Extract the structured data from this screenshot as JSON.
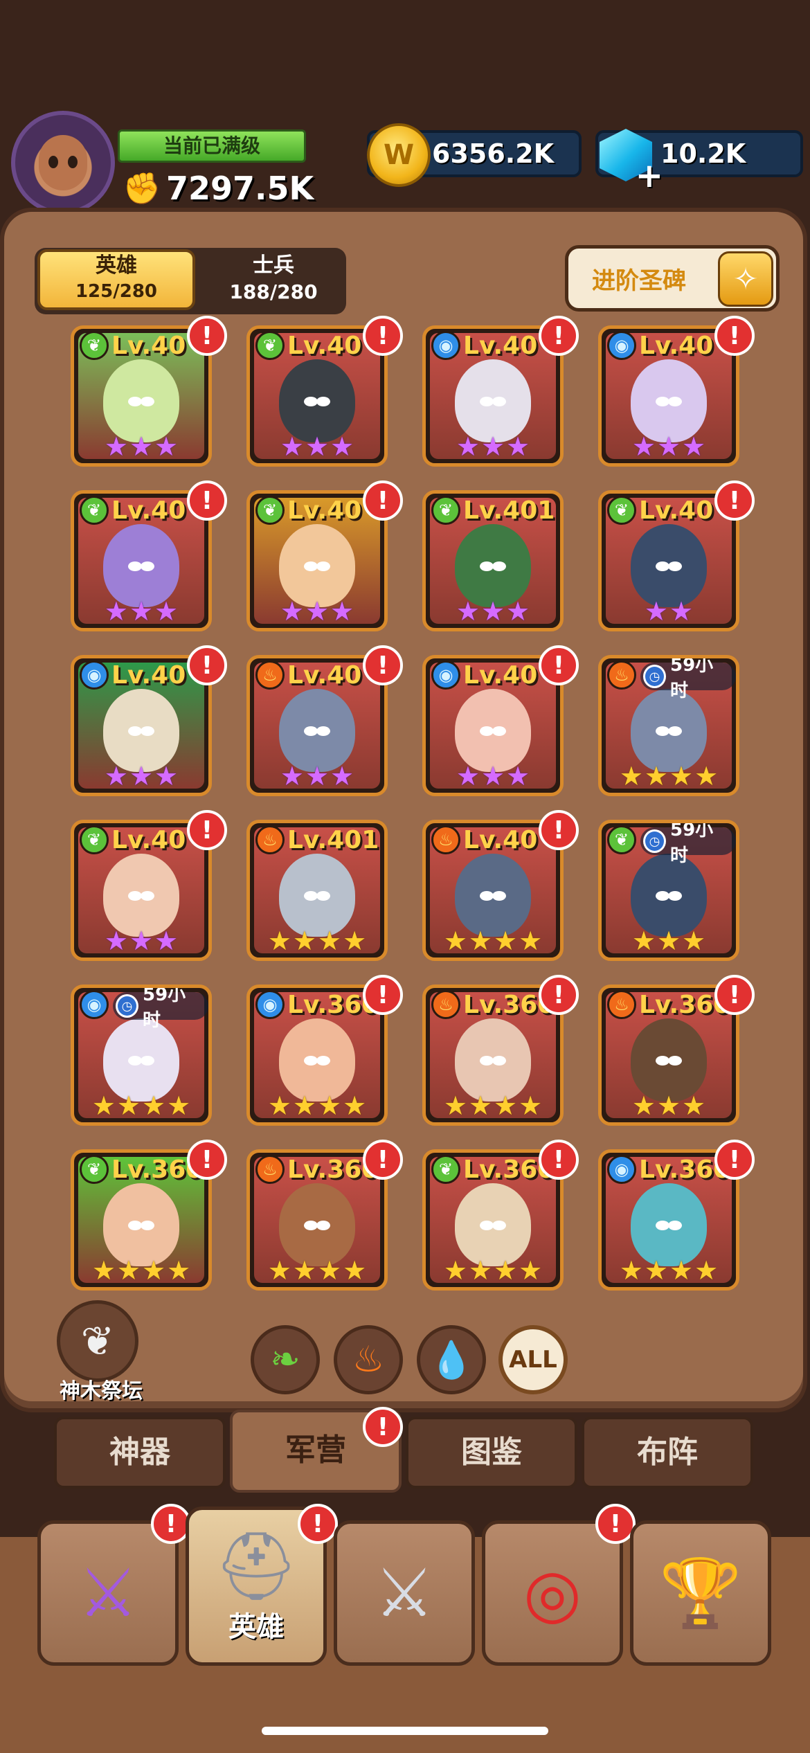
{
  "player": {
    "status_label": "当前已满级",
    "power": "7297.5K"
  },
  "resources": {
    "gold": "6356.2K",
    "gems": "10.2K"
  },
  "hero_tabs": {
    "hero_label": "英雄",
    "hero_count": "125/280",
    "soldier_label": "士兵",
    "soldier_count": "188/280"
  },
  "advance_button": {
    "label": "进阶圣碑",
    "icon": "compass-icon"
  },
  "heroes": [
    {
      "element": "leaf",
      "level": "Lv.40",
      "stars": 3,
      "star_color": "purple",
      "alert": true,
      "art": "#7bbf5a",
      "skin": "#cfe8a0"
    },
    {
      "element": "leaf",
      "level": "Lv.40",
      "stars": 3,
      "star_color": "purple",
      "alert": true,
      "art": "#c85048",
      "skin": "#3a3f45"
    },
    {
      "element": "water",
      "level": "Lv.40",
      "stars": 3,
      "star_color": "purple",
      "alert": true,
      "art": "#c85048",
      "skin": "#e5e0ea"
    },
    {
      "element": "water",
      "level": "Lv.40",
      "stars": 3,
      "star_color": "purple",
      "alert": true,
      "art": "#c85048",
      "skin": "#d9c8ee"
    },
    {
      "element": "leaf",
      "level": "Lv.40",
      "stars": 3,
      "star_color": "purple",
      "alert": true,
      "art": "#c85048",
      "skin": "#9d7fd6"
    },
    {
      "element": "leaf",
      "level": "Lv.40",
      "stars": 3,
      "star_color": "purple",
      "alert": true,
      "art": "#d99a2a",
      "skin": "#f2c79a"
    },
    {
      "element": "leaf",
      "level": "Lv.401",
      "stars": 3,
      "star_color": "purple",
      "alert": false,
      "art": "#c85048",
      "skin": "#3f7a44"
    },
    {
      "element": "leaf",
      "level": "Lv.40",
      "stars": 2,
      "star_color": "purple",
      "alert": true,
      "art": "#c85048",
      "skin": "#3a4c6a"
    },
    {
      "element": "water",
      "level": "Lv.40",
      "stars": 3,
      "star_color": "purple",
      "alert": true,
      "art": "#2d9a4a",
      "skin": "#e8dcc4"
    },
    {
      "element": "fire",
      "level": "Lv.40",
      "stars": 3,
      "star_color": "purple",
      "alert": true,
      "art": "#c85048",
      "skin": "#7d8aa8"
    },
    {
      "element": "water",
      "level": "Lv.40",
      "stars": 3,
      "star_color": "purple",
      "alert": true,
      "art": "#c85048",
      "skin": "#f2c0b0"
    },
    {
      "element": "fire",
      "timer": "59小时",
      "stars": 4,
      "star_color": "gold",
      "alert": false,
      "art": "#c85048",
      "skin": "#7d8aa8"
    },
    {
      "element": "leaf",
      "level": "Lv.40",
      "stars": 3,
      "star_color": "purple",
      "alert": true,
      "art": "#c85048",
      "skin": "#f0c8b0"
    },
    {
      "element": "fire",
      "level": "Lv.401",
      "stars": 4,
      "star_color": "gold",
      "alert": false,
      "art": "#c85048",
      "skin": "#b8c0cc"
    },
    {
      "element": "fire",
      "level": "Lv.40",
      "stars": 4,
      "star_color": "gold",
      "alert": true,
      "art": "#c85048",
      "skin": "#5a6a86"
    },
    {
      "element": "leaf",
      "timer": "59小时",
      "stars": 3,
      "star_color": "gold",
      "alert": false,
      "art": "#c85048",
      "skin": "#3a4c6a"
    },
    {
      "element": "water",
      "timer": "59小时",
      "stars": 4,
      "star_color": "gold",
      "alert": false,
      "art": "#c85048",
      "skin": "#e8e0f0"
    },
    {
      "element": "water",
      "level": "Lv.360",
      "stars": 4,
      "star_color": "gold",
      "alert": true,
      "art": "#c85048",
      "skin": "#f0b898"
    },
    {
      "element": "fire",
      "level": "Lv.360",
      "stars": 4,
      "star_color": "gold",
      "alert": true,
      "art": "#c85048",
      "skin": "#e8c6b2"
    },
    {
      "element": "fire",
      "level": "Lv.360",
      "stars": 3,
      "star_color": "gold",
      "alert": true,
      "art": "#c85048",
      "skin": "#6a4a34"
    },
    {
      "element": "leaf",
      "level": "Lv.360",
      "stars": 4,
      "star_color": "gold",
      "alert": true,
      "art": "#5ec43a",
      "skin": "#f0c0a0"
    },
    {
      "element": "fire",
      "level": "Lv.360",
      "stars": 4,
      "star_color": "gold",
      "alert": true,
      "art": "#c85048",
      "skin": "#a86a44"
    },
    {
      "element": "leaf",
      "level": "Lv.360",
      "stars": 4,
      "star_color": "gold",
      "alert": true,
      "art": "#c85048",
      "skin": "#e8d2b4"
    },
    {
      "element": "water",
      "level": "Lv.360",
      "stars": 4,
      "star_color": "gold",
      "alert": true,
      "art": "#c85048",
      "skin": "#5ab8c4"
    }
  ],
  "altar": {
    "label": "神木祭坛",
    "icon": "tree-altar-icon"
  },
  "filters": [
    {
      "name": "leaf",
      "icon": "leaf-icon"
    },
    {
      "name": "fire",
      "icon": "fire-icon"
    },
    {
      "name": "water",
      "icon": "water-drop-icon"
    },
    {
      "name": "all",
      "label": "ALL"
    }
  ],
  "sub_tabs": [
    {
      "label": "神器",
      "active": false,
      "alert": false
    },
    {
      "label": "军营",
      "active": true,
      "alert": true
    },
    {
      "label": "图鉴",
      "active": false,
      "alert": false
    },
    {
      "label": "布阵",
      "active": false,
      "alert": false
    }
  ],
  "bottom_nav": [
    {
      "icon": "sword-banner-icon",
      "label": "",
      "alert": true,
      "active": false
    },
    {
      "icon": "viking-helmet-icon",
      "label": "英雄",
      "alert": true,
      "active": true
    },
    {
      "icon": "crossed-swords-icon",
      "label": "",
      "alert": false,
      "active": false
    },
    {
      "icon": "target-icon",
      "label": "",
      "alert": true,
      "active": false
    },
    {
      "icon": "trophy-icon",
      "label": "",
      "alert": false,
      "active": false
    }
  ],
  "colors": {
    "panel": "#9a6b4c",
    "card_border": "#d98a2b",
    "alert": "#e23131",
    "level_text": "#ffd24a"
  }
}
